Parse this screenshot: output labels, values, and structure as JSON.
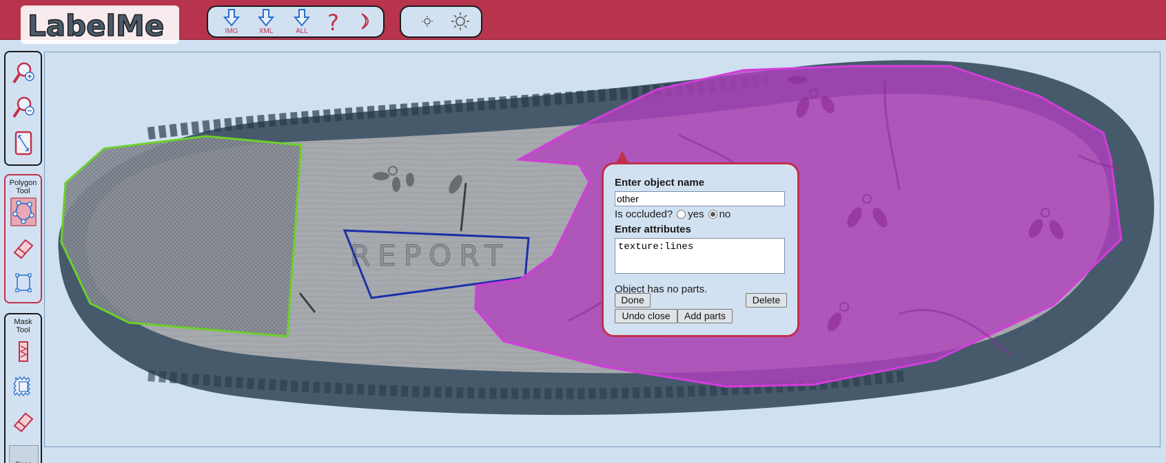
{
  "app": {
    "logo_text": "LabelMe"
  },
  "toolbar": {
    "download_img": "IMG",
    "download_xml": "XML",
    "download_all": "ALL",
    "help_icon": "question-mark-icon",
    "signout_icon": "moon-icon",
    "brightness_down_icon": "sun-small-icon",
    "brightness_up_icon": "sun-large-icon"
  },
  "sidebar": {
    "polygon_title_line1": "Polygon",
    "polygon_title_line2": "Tool",
    "mask_title_line1": "Mask",
    "mask_title_line2": "Tool",
    "done_partial": "Done"
  },
  "canvas": {
    "imprint_text": "REPORT",
    "polygon_colors": {
      "toe": "#6cd12a",
      "report": "#1a2fa8",
      "heel": "#c23cc9"
    }
  },
  "popup": {
    "name_heading": "Enter object name",
    "name_value": "other",
    "occluded_label": "Is occluded?",
    "occluded_yes": "yes",
    "occluded_no": "no",
    "occluded_selected": "no",
    "attributes_heading": "Enter attributes",
    "attributes_value": "texture:lines",
    "parts_text": "Object has no parts.",
    "done_button": "Done",
    "delete_button": "Delete",
    "undo_close_button": "Undo close",
    "add_parts_button": "Add parts"
  },
  "colors": {
    "header": "#b7344c",
    "accent_border": "#c0304a",
    "panel_bg": "#d2e1f2",
    "page_bg": "#cfe0f1"
  }
}
